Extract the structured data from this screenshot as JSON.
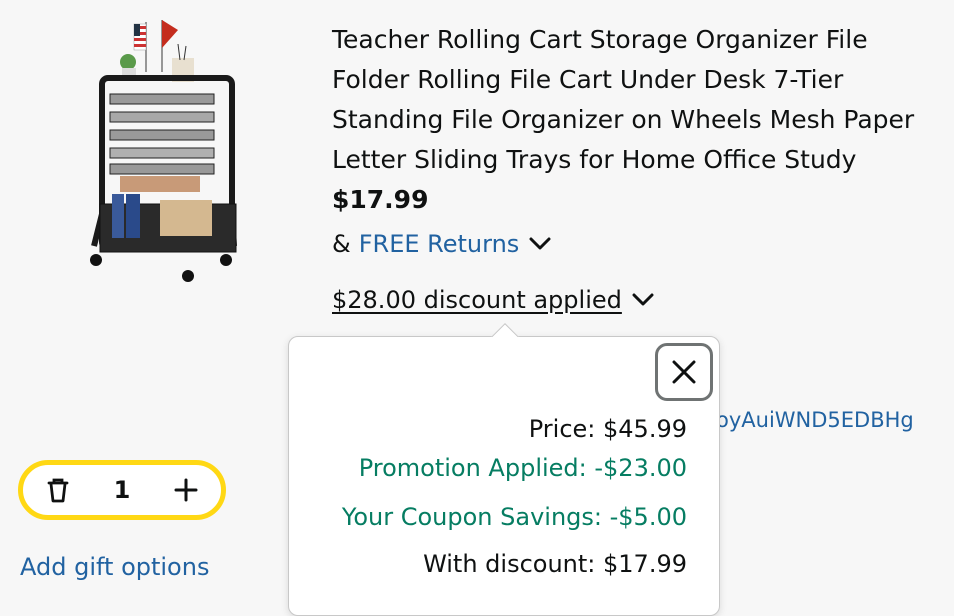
{
  "product": {
    "title": "Teacher Rolling Cart Storage Organizer File Folder Rolling File Cart Under Desk 7-Tier Standing File Organizer on Wheels Mesh Paper Letter Sliding Trays for Home Office Study",
    "price": "$17.99",
    "returns_prefix": "&",
    "returns_label": "FREE Returns",
    "discount_label": "$28.00 discount applied",
    "coupon_code_partial": "oyAuiWND5EDBHg"
  },
  "quantity": {
    "value": "1"
  },
  "gift_options_label": "Add gift options",
  "popover": {
    "price_row": "Price: $45.99",
    "promotion_row": "Promotion Applied: -$23.00",
    "coupon_row": "Your Coupon Savings: -$5.00",
    "with_discount_row": "With discount: $17.99"
  },
  "colors": {
    "link": "#2162a1",
    "savings_green": "#067d62",
    "qty_border": "#ffd814"
  },
  "icons": [
    "trash-icon",
    "plus-icon",
    "close-icon",
    "chevron-down-icon"
  ]
}
